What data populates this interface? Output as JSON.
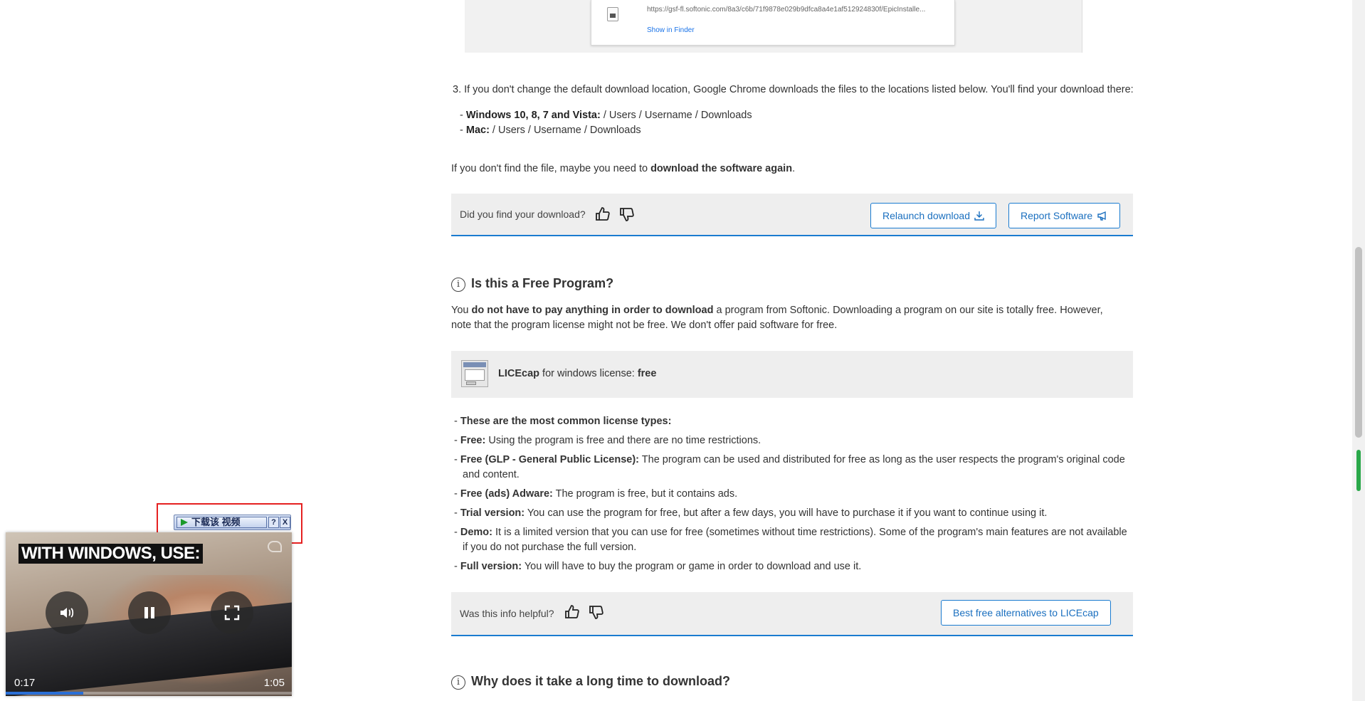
{
  "top_screenshot": {
    "url": "https://gsf-fl.softonic.com/8a3/c6b/71f9878e029b9dfca8a4e1af512924830f/EpicInstalle...",
    "show_in_finder": "Show in Finder"
  },
  "step3": {
    "number": "3.",
    "text": "If you don't change the default download location, Google Chrome downloads the files to the locations listed below. You'll find your download there:"
  },
  "paths": [
    {
      "label": "Windows 10, 8, 7 and Vista:",
      "value": " / Users / Username / Downloads"
    },
    {
      "label": "Mac:",
      "value": " / Users / Username / Downloads"
    }
  ],
  "again": {
    "prefix": "If you don't find the file, maybe you need to ",
    "bold": "download the software again",
    "suffix": "."
  },
  "feedback1": {
    "question": "Did you find your download?",
    "relaunch_label": "Relaunch download",
    "report_label": "Report Software"
  },
  "free_section": {
    "title": "Is this a Free Program?",
    "p_prefix": "You ",
    "p_bold": "do not have to pay anything in order to download",
    "p_suffix": " a program from Softonic. Downloading a program on our site is totally free. However, note that the program license might not be free. We don't offer paid software for free.",
    "app_name": "LICEcap",
    "license_mid": " for windows license: ",
    "license_value": "free"
  },
  "license_types": [
    {
      "label": "These are the most common license types:",
      "text": ""
    },
    {
      "label": "Free:",
      "text": " Using the program is free and there are no time restrictions."
    },
    {
      "label": "Free (GLP - General Public License):",
      "text": " The program can be used and distributed for free as long as the user respects the program's original code and content."
    },
    {
      "label": "Free (ads) Adware:",
      "text": " The program is free, but it contains ads."
    },
    {
      "label": "Trial version:",
      "text": " You can use the program for free, but after a few days, you will have to purchase it if you want to continue using it."
    },
    {
      "label": "Demo:",
      "text": " It is a limited version that you can use for free (sometimes without time restrictions). Some of the program's main features are not available if you do not purchase the full version."
    },
    {
      "label": "Full version:",
      "text": " You will have to buy the program or game in order to download and use it."
    }
  ],
  "feedback2": {
    "question": "Was this info helpful?",
    "alternatives_label": "Best free alternatives to LICEcap"
  },
  "next_section": {
    "title": "Why does it take a long time to download?"
  },
  "video_popup": {
    "download_button": "下载该 视频",
    "help": "?",
    "close": "X",
    "caption": "WITH WINDOWS, USE:",
    "current_time": "0:17",
    "duration": "1:05",
    "progress": 0.27
  }
}
